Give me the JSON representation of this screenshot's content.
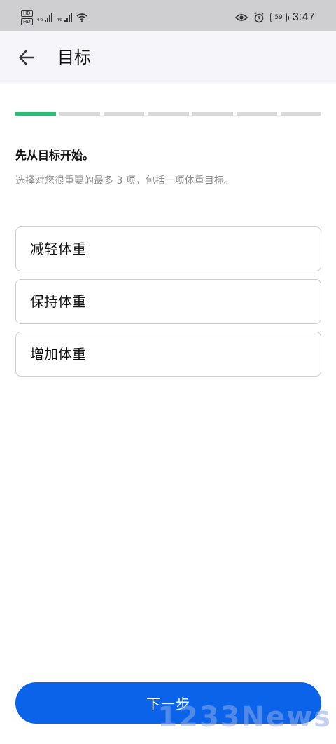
{
  "status_bar": {
    "hd1": "HD",
    "hd2": "HD",
    "net1": "46",
    "net2": "46",
    "battery": "59",
    "time": "3:47"
  },
  "header": {
    "title": "目标",
    "back_icon": "arrow-left-icon"
  },
  "progress": {
    "total_steps": 7,
    "current_step": 1,
    "active_color": "#2dbd75",
    "inactive_color": "#d9d9d9"
  },
  "content": {
    "headline": "先从目标开始。",
    "subhead": "选择对您很重要的最多 3 项，包括一项体重目标。",
    "options": [
      {
        "label": "减轻体重"
      },
      {
        "label": "保持体重"
      },
      {
        "label": "增加体重"
      }
    ]
  },
  "footer": {
    "next_label": "下一步",
    "button_color": "#0b63ea"
  },
  "watermark": {
    "text": "1233News"
  }
}
